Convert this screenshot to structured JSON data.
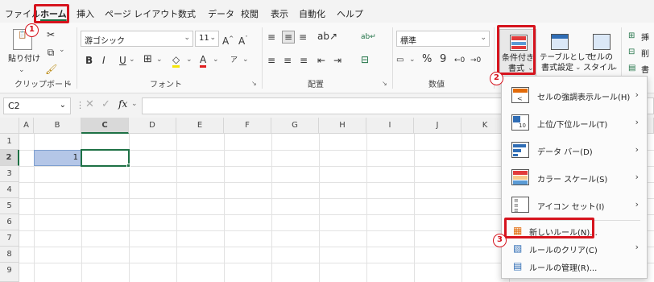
{
  "menu": {
    "tabs": [
      "ファイル",
      "ホーム",
      "挿入",
      "ページ レイアウト",
      "数式",
      "データ",
      "校閲",
      "表示",
      "自動化",
      "ヘルプ"
    ],
    "active_tab": "ホーム"
  },
  "ribbon": {
    "clipboard": {
      "paste_label": "貼り付け",
      "group_label": "クリップボード"
    },
    "font": {
      "font_name": "游ゴシック",
      "font_size": "11",
      "group_label": "フォント",
      "bold": "B",
      "italic": "I",
      "underline": "U"
    },
    "alignment": {
      "group_label": "配置"
    },
    "number": {
      "format": "標準",
      "percent": "%",
      "comma": "9",
      "group_label": "数値"
    },
    "styles": {
      "conditional_format_label_1": "条件付き",
      "conditional_format_label_2": "書式",
      "table_format_label_1": "テーブルとして",
      "table_format_label_2": "書式設定",
      "cell_style_label_1": "セルの",
      "cell_style_label_2": "スタイル"
    },
    "cells_partial": [
      "挿",
      "削",
      "書"
    ]
  },
  "formula_bar": {
    "name_box": "C2",
    "fx": "fx",
    "value": ""
  },
  "grid": {
    "columns": [
      "A",
      "B",
      "C",
      "D",
      "E",
      "F",
      "G",
      "H",
      "I",
      "J",
      "K"
    ],
    "rows": [
      "1",
      "2",
      "3",
      "4",
      "5",
      "6",
      "7",
      "8",
      "9"
    ],
    "b2_value": "1"
  },
  "cf_menu": {
    "items": [
      {
        "label": "セルの強調表示ルール(H)",
        "submenu": true
      },
      {
        "label": "上位/下位ルール(T)",
        "submenu": true
      },
      {
        "label": "データ バー(D)",
        "submenu": true
      },
      {
        "label": "カラー スケール(S)",
        "submenu": true
      },
      {
        "label": "アイコン セット(I)",
        "submenu": true
      },
      {
        "label": "新しいルール(N)...",
        "submenu": false
      },
      {
        "label": "ルールのクリア(C)",
        "submenu": true
      },
      {
        "label": "ルールの管理(R)...",
        "submenu": false
      }
    ]
  },
  "annotations": {
    "step1": "1",
    "step2": "2",
    "step3": "3"
  },
  "colors": {
    "accent": "#1e7145",
    "highlight": "#d6141e",
    "selection": "#b4c6e7"
  }
}
